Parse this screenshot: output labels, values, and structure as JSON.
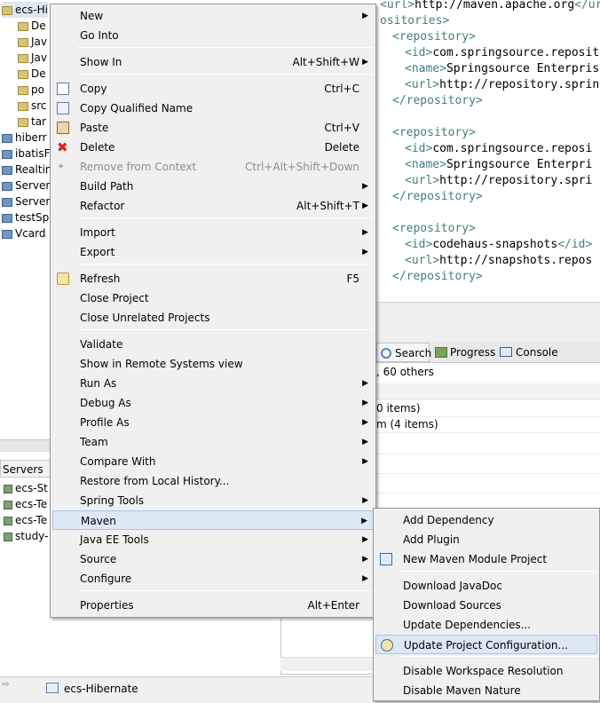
{
  "project_tree": {
    "items": [
      "ecs-Hi",
      "De",
      "Jav",
      "Jav",
      "De",
      "po",
      "src",
      "tar",
      "hiberr",
      "ibatisF",
      "Realtin",
      "Server",
      "Server",
      "testSp",
      "Vcard"
    ]
  },
  "servers_view": {
    "tab_label": "Servers",
    "items": [
      "ecs-St",
      "ecs-Te",
      "ecs-Te",
      "study-"
    ]
  },
  "editor": {
    "lines": [
      {
        "t": "<url>",
        "v": "http://maven.apache.org",
        "e": "</url>"
      },
      {
        "t": "ositories>",
        "v": "",
        "e": ""
      },
      {
        "t": "<repository>",
        "v": "",
        "e": ""
      },
      {
        "t": "<id>",
        "v": "com.springsource.reposito",
        "e": ""
      },
      {
        "t": "<name>",
        "v": "Springsource Enterprise",
        "e": ""
      },
      {
        "t": "<url>",
        "v": "http://repository.spring",
        "e": ""
      },
      {
        "t": "</repository>",
        "v": "",
        "e": ""
      },
      {
        "t": "",
        "v": "",
        "e": ""
      },
      {
        "t": "<repository>",
        "v": "",
        "e": ""
      },
      {
        "t": "<id>",
        "v": "com.springsource.reposi",
        "e": ""
      },
      {
        "t": "<name>",
        "v": "Springsource Enterpri",
        "e": ""
      },
      {
        "t": "<url>",
        "v": "http://repository.spri",
        "e": ""
      },
      {
        "t": "</repository>",
        "v": "",
        "e": ""
      },
      {
        "t": "",
        "v": "",
        "e": ""
      },
      {
        "t": "<repository>",
        "v": "",
        "e": ""
      },
      {
        "t": "<id>",
        "v": "codehaus-snapshots",
        "e": "</id>"
      },
      {
        "t": "<url>",
        "v": "http://snapshots.repos",
        "e": ""
      },
      {
        "t": "</repository>",
        "v": "",
        "e": ""
      }
    ]
  },
  "bottom_tabs": {
    "search": "Search",
    "progress": "Progress",
    "console": "Console"
  },
  "problems": {
    "summary": ", 60 others",
    "rows": [
      "0 items)",
      "m (4 items)"
    ]
  },
  "status_bar": {
    "project": "ecs-Hibernate"
  },
  "context_menu": {
    "items": [
      {
        "label": "New",
        "arrow": true
      },
      {
        "label": "Go Into"
      },
      {
        "sep": true
      },
      {
        "label": "Show In",
        "accel": "Alt+Shift+W",
        "arrow": true
      },
      {
        "sep": true
      },
      {
        "label": "Copy",
        "accel": "Ctrl+C",
        "icon": "copy-icon"
      },
      {
        "label": "Copy Qualified Name",
        "icon": "copy-qualified-icon"
      },
      {
        "label": "Paste",
        "accel": "Ctrl+V",
        "icon": "paste-icon"
      },
      {
        "label": "Delete",
        "accel": "Delete",
        "icon": "delete-icon"
      },
      {
        "label": "Remove from Context",
        "accel": "Ctrl+Alt+Shift+Down",
        "disabled": true,
        "icon": "remove-context-icon"
      },
      {
        "label": "Build Path",
        "arrow": true
      },
      {
        "label": "Refactor",
        "accel": "Alt+Shift+T",
        "arrow": true
      },
      {
        "sep": true
      },
      {
        "label": "Import",
        "arrow": true
      },
      {
        "label": "Export",
        "arrow": true
      },
      {
        "sep": true
      },
      {
        "label": "Refresh",
        "accel": "F5",
        "icon": "refresh-icon"
      },
      {
        "label": "Close Project"
      },
      {
        "label": "Close Unrelated Projects"
      },
      {
        "sep": true
      },
      {
        "label": "Validate"
      },
      {
        "label": "Show in Remote Systems view"
      },
      {
        "label": "Run As",
        "arrow": true
      },
      {
        "label": "Debug As",
        "arrow": true
      },
      {
        "label": "Profile As",
        "arrow": true
      },
      {
        "label": "Team",
        "arrow": true
      },
      {
        "label": "Compare With",
        "arrow": true
      },
      {
        "label": "Restore from Local History..."
      },
      {
        "label": "Spring Tools",
        "arrow": true
      },
      {
        "label": "Maven",
        "arrow": true,
        "highlight": true
      },
      {
        "label": "Java EE Tools",
        "arrow": true
      },
      {
        "label": "Source",
        "arrow": true
      },
      {
        "label": "Configure",
        "arrow": true
      },
      {
        "sep": true
      },
      {
        "label": "Properties",
        "accel": "Alt+Enter"
      }
    ]
  },
  "maven_submenu": {
    "items": [
      {
        "label": "Add Dependency"
      },
      {
        "label": "Add Plugin"
      },
      {
        "label": "New Maven Module Project",
        "icon": "maven-module-icon"
      },
      {
        "sep": true
      },
      {
        "label": "Download JavaDoc"
      },
      {
        "label": "Download Sources"
      },
      {
        "label": "Update Dependencies..."
      },
      {
        "label": "Update Project Configuration...",
        "highlight": true,
        "icon": "update-config-icon"
      },
      {
        "sep": true
      },
      {
        "label": "Disable Workspace Resolution"
      },
      {
        "label": "Disable Maven Nature"
      }
    ]
  }
}
